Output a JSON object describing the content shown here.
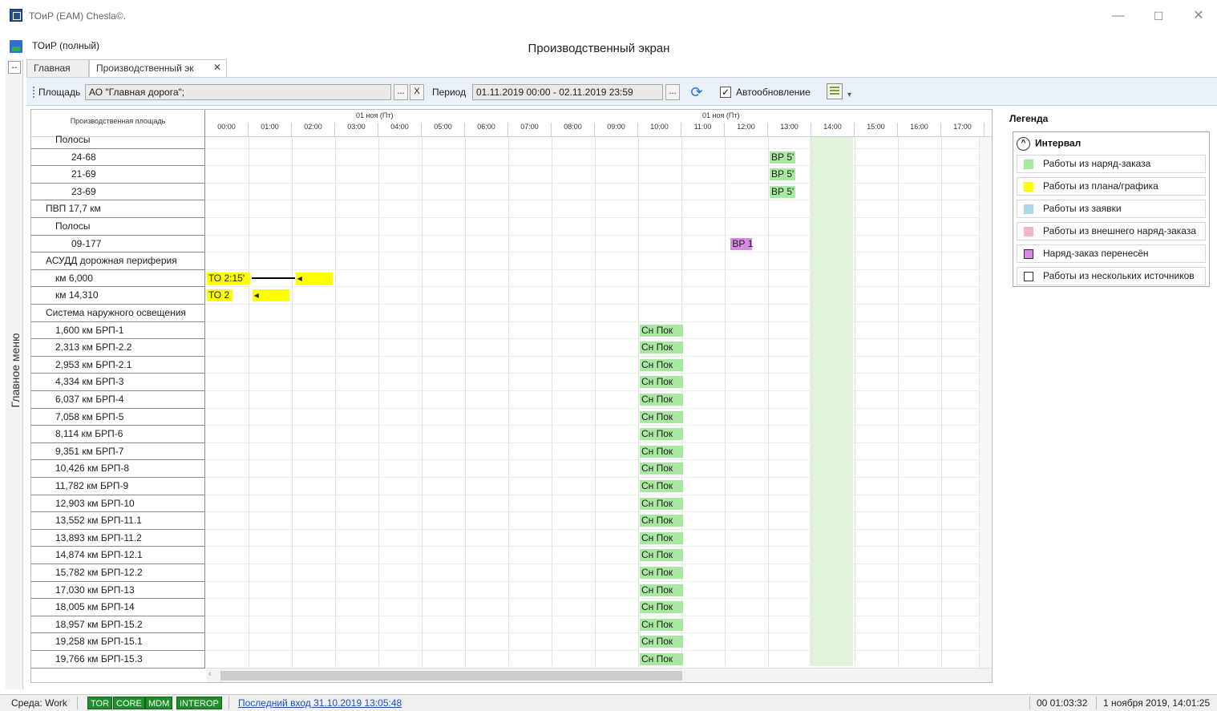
{
  "window": {
    "title": "ТОиР (EAM) Chesla©.",
    "min_glyph": "—",
    "max_glyph": "☐",
    "close_glyph": "✕"
  },
  "app": {
    "name": "ТОиР (полный)",
    "screen_title": "Производственный экран"
  },
  "side_menu": {
    "toggle_glyph": "↔",
    "label": "Главное меню"
  },
  "tabs": [
    {
      "label": "Главная"
    },
    {
      "label": "Производственный эк",
      "close": "✕"
    }
  ],
  "toolbar": {
    "area_label": "Площадь",
    "area_value": "АО \"Главная дорога\";",
    "ellipsis": "...",
    "clear": "X",
    "period_label": "Период",
    "period_value": "01.11.2019 00:00 - 02.11.2019 23:59",
    "refresh_glyph": "⟳",
    "autoupdate_label": "Автообновление",
    "autoupdate_checked": "✓",
    "more_glyph": "▾"
  },
  "grid": {
    "column_header": "Производственная площадь",
    "day_labels": [
      "01 ноя (Пт)",
      "01 ноя (Пт)"
    ],
    "hours": [
      "00:00",
      "01:00",
      "02:00",
      "03:00",
      "04:00",
      "05:00",
      "06:00",
      "07:00",
      "08:00",
      "09:00",
      "10:00",
      "11:00",
      "12:00",
      "13:00",
      "14:00",
      "15:00",
      "16:00",
      "17:00"
    ],
    "rows": [
      {
        "name": "Полосы",
        "indent": 2
      },
      {
        "name": "24-68",
        "indent": 3
      },
      {
        "name": "21-69",
        "indent": 3
      },
      {
        "name": "23-69",
        "indent": 3
      },
      {
        "name": "ПВП 17,7 км",
        "indent": 1
      },
      {
        "name": "Полосы",
        "indent": 2
      },
      {
        "name": "09-177",
        "indent": 3
      },
      {
        "name": "АСУДД дорожная периферия",
        "indent": 1
      },
      {
        "name": "км 6,000",
        "indent": 2
      },
      {
        "name": "км 14,310",
        "indent": 2
      },
      {
        "name": "Система наружного освещения",
        "indent": 1
      },
      {
        "name": "1,600 км БРП-1",
        "indent": 2
      },
      {
        "name": "2,313 км БРП-2.2",
        "indent": 2
      },
      {
        "name": "2,953 км БРП-2.1",
        "indent": 2
      },
      {
        "name": "4,334 км БРП-3",
        "indent": 2
      },
      {
        "name": "6,037 км БРП-4",
        "indent": 2
      },
      {
        "name": "7,058 км БРП-5",
        "indent": 2
      },
      {
        "name": "8,114 км БРП-6",
        "indent": 2
      },
      {
        "name": "9,351 км БРП-7",
        "indent": 2
      },
      {
        "name": "10,426 км БРП-8",
        "indent": 2
      },
      {
        "name": "11,782 км БРП-9",
        "indent": 2
      },
      {
        "name": "12,903 км БРП-10",
        "indent": 2
      },
      {
        "name": "13,552 км БРП-11.1",
        "indent": 2
      },
      {
        "name": "13,893 км БРП-11.2",
        "indent": 2
      },
      {
        "name": "14,874 км БРП-12.1",
        "indent": 2
      },
      {
        "name": "15,782 км БРП-12.2",
        "indent": 2
      },
      {
        "name": "17,030 км БРП-13",
        "indent": 2
      },
      {
        "name": "18,005 км БРП-14",
        "indent": 2
      },
      {
        "name": "18,957 км БРП-15.2",
        "indent": 2
      },
      {
        "name": "19,258 км БРП-15.1",
        "indent": 2
      },
      {
        "name": "19,766 км БРП-15.3",
        "indent": 2
      }
    ],
    "bars": [
      {
        "row": 1,
        "start": 13.0,
        "end": 13.6,
        "label": "ВР 5'",
        "type": "green"
      },
      {
        "row": 2,
        "start": 13.0,
        "end": 13.6,
        "label": "ВР 5'",
        "type": "green"
      },
      {
        "row": 3,
        "start": 13.0,
        "end": 13.6,
        "label": "ВР 5'",
        "type": "green"
      },
      {
        "row": 6,
        "start": 12.1,
        "end": 12.6,
        "label": "ВР 1",
        "type": "purple"
      },
      {
        "row": 8,
        "start": 0.0,
        "end": 1.0,
        "label": "ТО 2:15'",
        "type": "yellow"
      },
      {
        "row": 8,
        "start": 2.05,
        "end": 2.9,
        "label": "◂",
        "type": "yellow"
      },
      {
        "row": 9,
        "start": 0.0,
        "end": 0.6,
        "label": "ТО 2",
        "type": "yellow"
      },
      {
        "row": 9,
        "start": 1.05,
        "end": 1.9,
        "label": "◂",
        "type": "yellow"
      },
      {
        "row": 11,
        "start": 10.0,
        "end": 11.0,
        "label": "Сн Пок",
        "type": "green"
      },
      {
        "row": 12,
        "start": 10.0,
        "end": 11.0,
        "label": "Сн Пок",
        "type": "green"
      },
      {
        "row": 13,
        "start": 10.0,
        "end": 11.0,
        "label": "Сн Пок",
        "type": "green"
      },
      {
        "row": 14,
        "start": 10.0,
        "end": 11.0,
        "label": "Сн Пок",
        "type": "green"
      },
      {
        "row": 15,
        "start": 10.0,
        "end": 11.0,
        "label": "Сн Пок",
        "type": "green"
      },
      {
        "row": 16,
        "start": 10.0,
        "end": 11.0,
        "label": "Сн Пок",
        "type": "green"
      },
      {
        "row": 17,
        "start": 10.0,
        "end": 11.0,
        "label": "Сн Пок",
        "type": "green"
      },
      {
        "row": 18,
        "start": 10.0,
        "end": 11.0,
        "label": "Сн Пок",
        "type": "green"
      },
      {
        "row": 19,
        "start": 10.0,
        "end": 11.0,
        "label": "Сн Пок",
        "type": "green"
      },
      {
        "row": 20,
        "start": 10.0,
        "end": 11.0,
        "label": "Сн Пок",
        "type": "green"
      },
      {
        "row": 21,
        "start": 10.0,
        "end": 11.0,
        "label": "Сн Пок",
        "type": "green"
      },
      {
        "row": 22,
        "start": 10.0,
        "end": 11.0,
        "label": "Сн Пок",
        "type": "green"
      },
      {
        "row": 23,
        "start": 10.0,
        "end": 11.0,
        "label": "Сн Пок",
        "type": "green"
      },
      {
        "row": 24,
        "start": 10.0,
        "end": 11.0,
        "label": "Сн Пок",
        "type": "green"
      },
      {
        "row": 25,
        "start": 10.0,
        "end": 11.0,
        "label": "Сн Пок",
        "type": "green"
      },
      {
        "row": 26,
        "start": 10.0,
        "end": 11.0,
        "label": "Сн Пок",
        "type": "green"
      },
      {
        "row": 27,
        "start": 10.0,
        "end": 11.0,
        "label": "Сн Пок",
        "type": "green"
      },
      {
        "row": 28,
        "start": 10.0,
        "end": 11.0,
        "label": "Сн Пок",
        "type": "green"
      },
      {
        "row": 29,
        "start": 10.0,
        "end": 11.0,
        "label": "Сн Пок",
        "type": "green"
      },
      {
        "row": 30,
        "start": 10.0,
        "end": 11.0,
        "label": "Сн Пок",
        "type": "green"
      }
    ],
    "links": [
      {
        "row": 8,
        "start": 1.0,
        "end": 2.0
      }
    ],
    "highlight_hour": "14:00"
  },
  "legend": {
    "title": "Легенда",
    "group": "Интервал",
    "group_glyph": "^",
    "items": [
      {
        "label": "Работы из наряд-заказа",
        "color": "#a8e8a0"
      },
      {
        "label": "Работы из плана/графика",
        "color": "#ffff00"
      },
      {
        "label": "Работы из заявки",
        "color": "#add8e6"
      },
      {
        "label": "Работы из внешнего наряд-заказа",
        "color": "#f4b6c2"
      },
      {
        "label": "Наряд-заказ перенесён",
        "color": "#d58be0"
      },
      {
        "label": "Работы из нескольких источников",
        "color": "#ffffff"
      }
    ]
  },
  "status": {
    "env": "Среда: Work",
    "badges": [
      "TOR",
      "CORE",
      "MDM",
      "INTEROP"
    ],
    "last_login": "Последний вход 31.10.2019 13:05:48",
    "timer": "00 01:03:32",
    "datetime": "1 ноября 2019, 14:01:25"
  },
  "colors": {
    "accent_green": "#1f8f2b",
    "toolbar_bg": "#eaf1f9",
    "highlight_col": "#e3f4dd"
  }
}
